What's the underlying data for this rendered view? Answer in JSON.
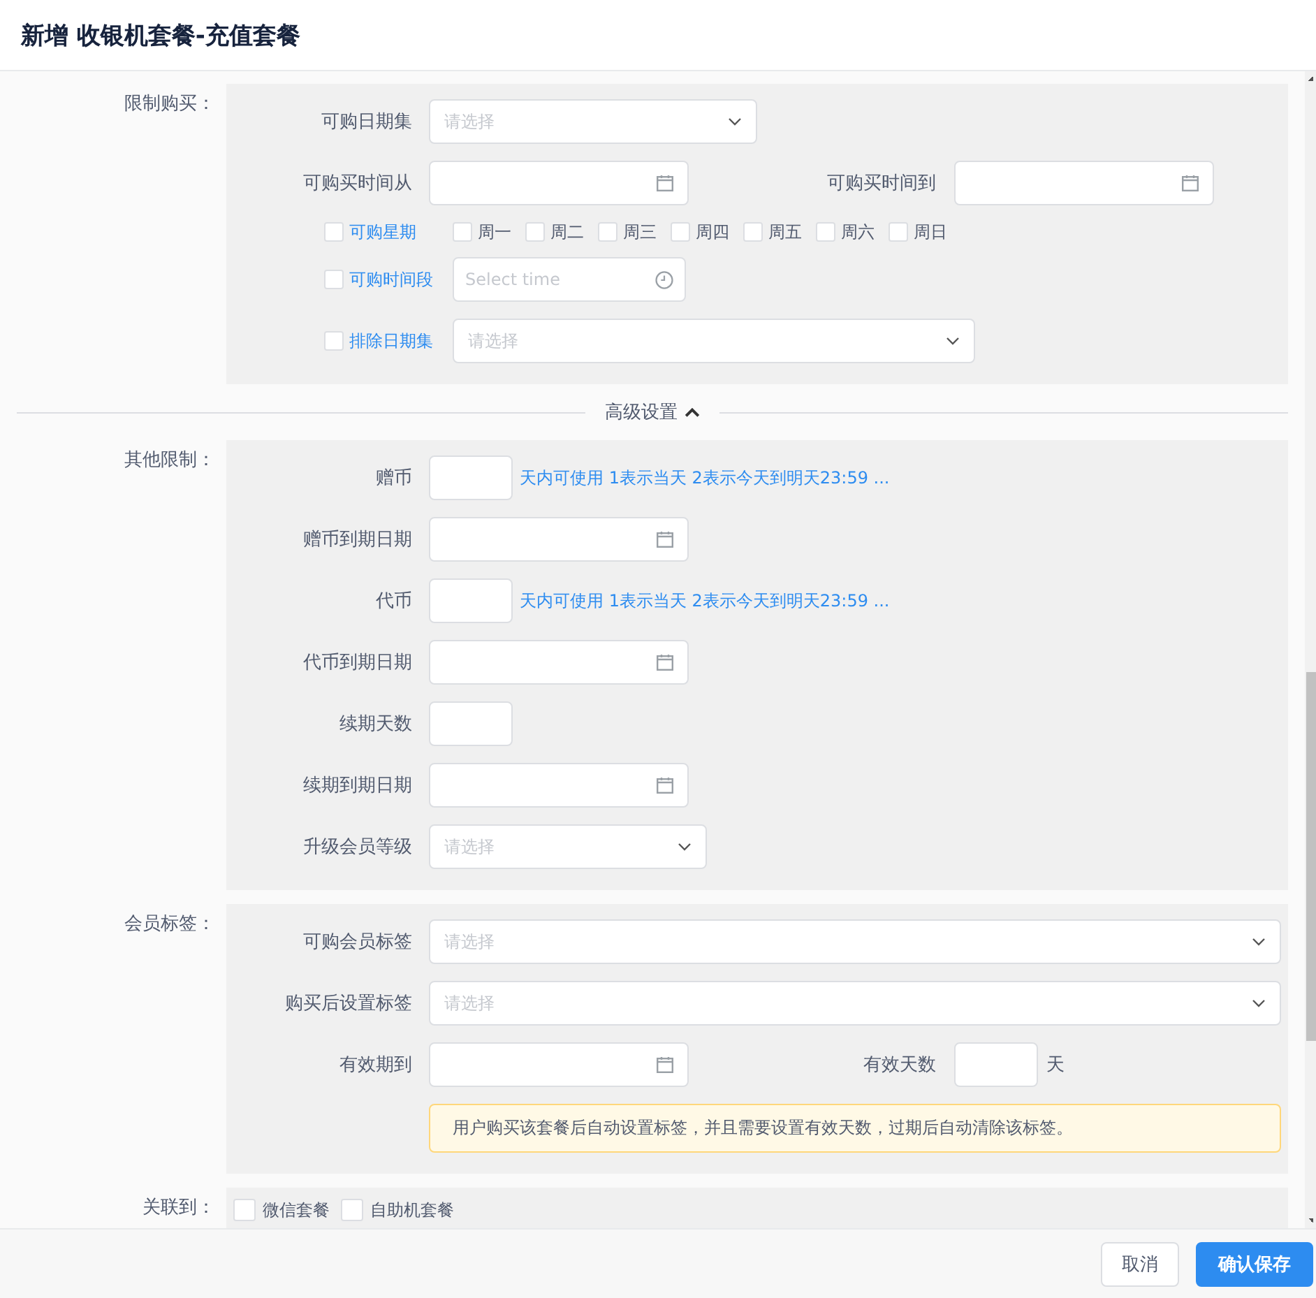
{
  "dialog": {
    "title": "新增 收银机套餐-充值套餐"
  },
  "sections": [
    {
      "label": "限制购买：",
      "rows": [
        {
          "items": [
            {
              "kind": "label",
              "text": "可购日期集"
            },
            {
              "kind": "select",
              "placeholder": "请选择"
            }
          ]
        },
        {
          "items": [
            {
              "kind": "label",
              "text": "可购买时间从"
            },
            {
              "kind": "date"
            },
            {
              "kind": "label",
              "text": "可购买时间到"
            },
            {
              "kind": "date"
            }
          ]
        },
        {
          "items": [
            {
              "kind": "option",
              "label": "可购星期",
              "checked": false
            },
            {
              "kind": "checkbox",
              "label": "周一",
              "checked": false
            },
            {
              "kind": "checkbox",
              "label": "周二",
              "checked": false
            },
            {
              "kind": "checkbox",
              "label": "周三",
              "checked": false
            },
            {
              "kind": "checkbox",
              "label": "周四",
              "checked": false
            },
            {
              "kind": "checkbox",
              "label": "周五",
              "checked": false
            },
            {
              "kind": "checkbox",
              "label": "周六",
              "checked": false
            },
            {
              "kind": "checkbox",
              "label": "周日",
              "checked": false
            }
          ]
        },
        {
          "items": [
            {
              "kind": "option",
              "label": "可购时间段",
              "checked": false
            },
            {
              "kind": "time",
              "placeholder": "Select time"
            }
          ]
        },
        {
          "items": [
            {
              "kind": "option",
              "label": "排除日期集",
              "checked": false
            },
            {
              "kind": "select",
              "placeholder": "请选择"
            }
          ]
        }
      ]
    },
    {
      "kind": "divider",
      "label": "高级设置",
      "expanded": true
    },
    {
      "label": "其他限制：",
      "rows": [
        {
          "items": [
            {
              "kind": "label",
              "text": "赠币"
            },
            {
              "kind": "input"
            },
            {
              "kind": "hint",
              "text": "天内可使用 1表示当天 2表示今天到明天23:59 ..."
            }
          ]
        },
        {
          "items": [
            {
              "kind": "label",
              "text": "赠币到期日期"
            },
            {
              "kind": "date"
            }
          ]
        },
        {
          "items": [
            {
              "kind": "label",
              "text": "代币"
            },
            {
              "kind": "input"
            },
            {
              "kind": "hint",
              "text": "天内可使用 1表示当天 2表示今天到明天23:59 ..."
            }
          ]
        },
        {
          "items": [
            {
              "kind": "label",
              "text": "代币到期日期"
            },
            {
              "kind": "date"
            }
          ]
        },
        {
          "items": [
            {
              "kind": "label",
              "text": "续期天数"
            },
            {
              "kind": "input"
            }
          ]
        },
        {
          "items": [
            {
              "kind": "label",
              "text": "续期到期日期"
            },
            {
              "kind": "date"
            }
          ]
        },
        {
          "items": [
            {
              "kind": "label",
              "text": "升级会员等级"
            },
            {
              "kind": "select",
              "placeholder": "请选择"
            }
          ]
        }
      ]
    },
    {
      "label": "会员标签：",
      "rows": [
        {
          "items": [
            {
              "kind": "label",
              "text": "可购会员标签"
            },
            {
              "kind": "select",
              "placeholder": "请选择"
            }
          ]
        },
        {
          "items": [
            {
              "kind": "label",
              "text": "购买后设置标签"
            },
            {
              "kind": "select",
              "placeholder": "请选择"
            }
          ]
        },
        {
          "items": [
            {
              "kind": "label",
              "text": "有效期到"
            },
            {
              "kind": "date"
            },
            {
              "kind": "label",
              "text": "有效天数"
            },
            {
              "kind": "input"
            },
            {
              "kind": "text",
              "text": "天"
            }
          ]
        },
        {
          "items": [
            {
              "kind": "alert",
              "text": "用户购买该套餐后自动设置标签，并且需要设置有效天数，过期后自动清除该标签。"
            }
          ]
        }
      ]
    },
    {
      "label": "关联到：",
      "rows": [
        {
          "items": [
            {
              "kind": "checkbox",
              "label": "微信套餐",
              "checked": false
            },
            {
              "kind": "checkbox",
              "label": "自助机套餐",
              "checked": false
            }
          ]
        }
      ]
    }
  ],
  "buttons": [
    {
      "label": "取消",
      "primary": false
    },
    {
      "label": "确认保存",
      "primary": true
    }
  ]
}
